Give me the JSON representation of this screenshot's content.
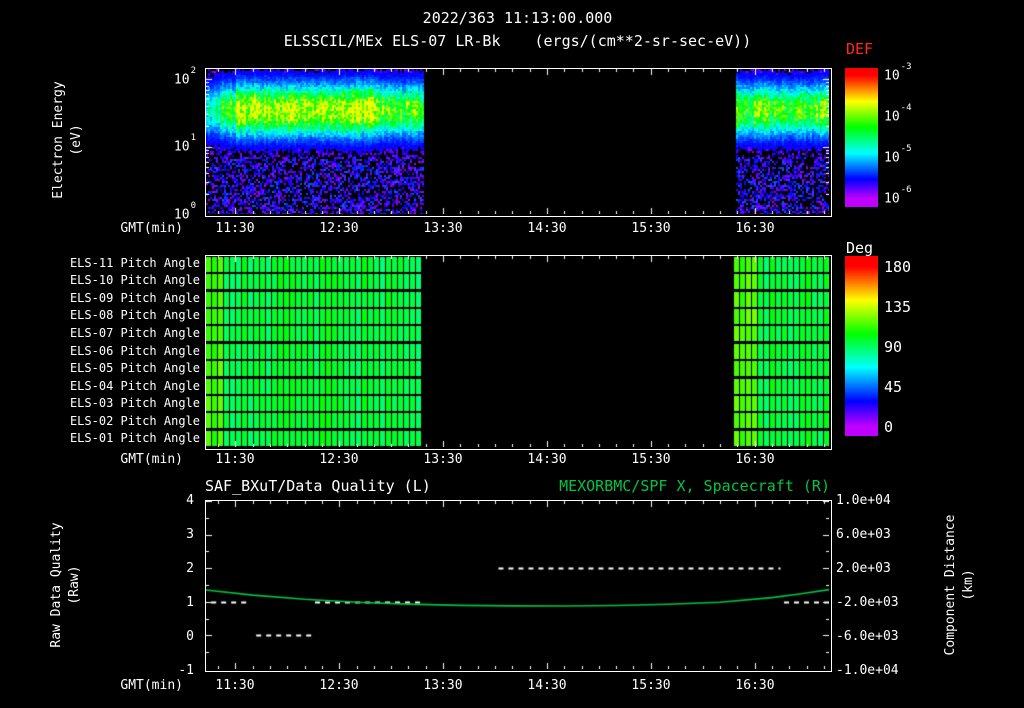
{
  "colors": {
    "background": "#000000",
    "text": "#ffffff",
    "def_title": "#ff2a1a",
    "accent_green": "#00c444"
  },
  "chart_data": [
    {
      "type": "heatmap",
      "name": "electron-energy-spectrogram",
      "title": "2022/363 11:13:00.000",
      "instrument": "ELSSCIL/MEx ELS-07 LR-Bk",
      "units": "(ergs/(cm**2-sr-sec-eV))",
      "ylabel": "Electron Energy",
      "ylabel_unit": "(eV)",
      "yscale": "log",
      "ylim_ev": [
        1,
        140
      ],
      "yticks": [
        {
          "base": "10",
          "exp": "2"
        },
        {
          "base": "10",
          "exp": "1"
        },
        {
          "base": "10",
          "exp": "0"
        }
      ],
      "xlabel": "GMT(min)",
      "xticks": [
        "11:30",
        "12:30",
        "13:30",
        "14:30",
        "15:30",
        "16:30"
      ],
      "xtick_minutes": [
        690,
        750,
        810,
        870,
        930,
        990
      ],
      "x_range_min": [
        673,
        1033
      ],
      "colorbar": {
        "title": "DEF",
        "ticks": [
          {
            "base": "10",
            "exp": "-3"
          },
          {
            "base": "10",
            "exp": "-4"
          },
          {
            "base": "10",
            "exp": "-5"
          },
          {
            "base": "10",
            "exp": "-6"
          }
        ],
        "range_exp": [
          -6,
          -3
        ]
      },
      "data_segments": [
        {
          "start_min": 673,
          "end_min": 798
        },
        {
          "start_min": 979,
          "end_min": 1033
        }
      ],
      "bright_core": {
        "start_min": 683,
        "end_min": 768,
        "band_ev": [
          20,
          70
        ]
      },
      "description": "Electron flux spectrogram; bright green-yellow band 15-70 eV during data intervals, purple speckle below ~7 eV, black data gap 13:18-16:19"
    },
    {
      "type": "heatmap",
      "name": "pitch-angle-panels",
      "rows": [
        "ELS-11 Pitch Angle",
        "ELS-10 Pitch Angle",
        "ELS-09 Pitch Angle",
        "ELS-08 Pitch Angle",
        "ELS-07 Pitch Angle",
        "ELS-06 Pitch Angle",
        "ELS-05 Pitch Angle",
        "ELS-04 Pitch Angle",
        "ELS-03 Pitch Angle",
        "ELS-02 Pitch Angle",
        "ELS-01 Pitch Angle"
      ],
      "xlabel": "GMT(min)",
      "xticks": [
        "11:30",
        "12:30",
        "13:30",
        "14:30",
        "15:30",
        "16:30"
      ],
      "xtick_minutes": [
        690,
        750,
        810,
        870,
        930,
        990
      ],
      "colorbar": {
        "title": "Deg",
        "ticks": [
          "180",
          "135",
          "90",
          "45",
          "0"
        ],
        "range": [
          0,
          180
        ]
      },
      "typical_deg": 95,
      "data_segments": [
        {
          "start_min": 673,
          "end_min": 798
        },
        {
          "start_min": 979,
          "end_min": 1033
        }
      ],
      "description": "Pitch angle near 90-110 deg (green) for all anodes during data intervals"
    },
    {
      "type": "line",
      "name": "quality-and-distance",
      "title_left": "SAF_BXuT/Data Quality (L)",
      "title_right": "MEXORBMC/SPF X, Spacecraft (R)",
      "ylabel_left": "Raw Data Quality",
      "ylabel_left_unit": "(Raw)",
      "ylabel_right": "Component Distance",
      "ylabel_right_unit": "(km)",
      "yticks_left": [
        "4",
        "3",
        "2",
        "1",
        "0",
        "-1"
      ],
      "ylim_left": [
        -1,
        4
      ],
      "yticks_right": [
        "1.0e+04",
        "6.0e+03",
        "2.0e+03",
        "-2.0e+03",
        "-6.0e+03",
        "-1.0e+04"
      ],
      "ylim_right": [
        -10000,
        10000
      ],
      "xlabel": "GMT(min)",
      "xticks": [
        "11:30",
        "12:30",
        "13:30",
        "14:30",
        "15:30",
        "16:30"
      ],
      "xtick_minutes": [
        690,
        750,
        810,
        870,
        930,
        990
      ],
      "series": [
        {
          "name": "SAF_BXuT/Data Quality",
          "axis": "left",
          "style": "dashed",
          "color": "#ffffff",
          "segments": [
            {
              "value": 1,
              "start_min": 676,
              "end_min": 697
            },
            {
              "value": 0,
              "start_min": 702,
              "end_min": 736
            },
            {
              "value": 1,
              "start_min": 736,
              "end_min": 798
            },
            {
              "value": 2,
              "start_min": 842,
              "end_min": 1005
            },
            {
              "value": 1,
              "start_min": 1007,
              "end_min": 1033
            }
          ]
        },
        {
          "name": "MEXORBMC/SPF X, Spacecraft",
          "axis": "right",
          "style": "solid",
          "color": "#00c444",
          "points": [
            [
              673,
              -600
            ],
            [
              700,
              -1200
            ],
            [
              730,
              -1700
            ],
            [
              760,
              -2050
            ],
            [
              790,
              -2280
            ],
            [
              820,
              -2420
            ],
            [
              850,
              -2490
            ],
            [
              880,
              -2500
            ],
            [
              910,
              -2440
            ],
            [
              940,
              -2300
            ],
            [
              970,
              -2050
            ],
            [
              1000,
              -1500
            ],
            [
              1015,
              -1100
            ],
            [
              1033,
              -550
            ]
          ]
        }
      ]
    }
  ]
}
